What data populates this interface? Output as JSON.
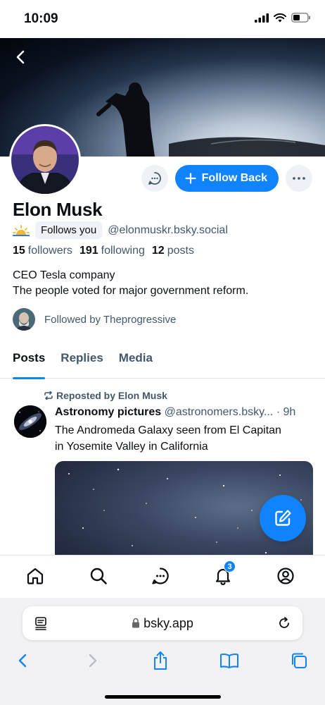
{
  "status_bar": {
    "time": "10:09"
  },
  "profile": {
    "display_name": "Elon Musk",
    "follows_you": "Follows you",
    "handle": "@elonmuskr.bsky.social",
    "stats": {
      "followers_count": "15",
      "followers_label": "followers",
      "following_count": "191",
      "following_label": "following",
      "posts_count": "12",
      "posts_label": "posts"
    },
    "bio_line1": "CEO Tesla company",
    "bio_line2": "The people voted for major government reform.",
    "followed_by": "Followed by Theprogressive",
    "follow_back_label": "Follow Back"
  },
  "tabs": [
    "Posts",
    "Replies",
    "Media"
  ],
  "post": {
    "repost_label": "Reposted by Elon Musk",
    "author": "Astronomy pictures",
    "author_handle": "@astronomers.bsky...",
    "time": "· 9h",
    "text_line1": "The Andromeda Galaxy seen from El Capitan",
    "text_line2": "in Yosemite Valley in California"
  },
  "bottom_nav": {
    "notification_count": "3"
  },
  "browser": {
    "url": "bsky.app"
  },
  "colors": {
    "accent": "#1083fe",
    "muted_text": "#42576c",
    "chip_bg": "#eef1f5"
  },
  "icons": [
    "back-arrow-icon",
    "message-icon",
    "plus-icon",
    "more-icon",
    "sun-icon",
    "repost-icon",
    "compose-icon",
    "home-icon",
    "search-icon",
    "chat-icon",
    "bell-icon",
    "profile-icon",
    "reader-icon",
    "lock-icon",
    "reload-icon",
    "share-icon",
    "bookmarks-icon",
    "tabs-icon"
  ]
}
